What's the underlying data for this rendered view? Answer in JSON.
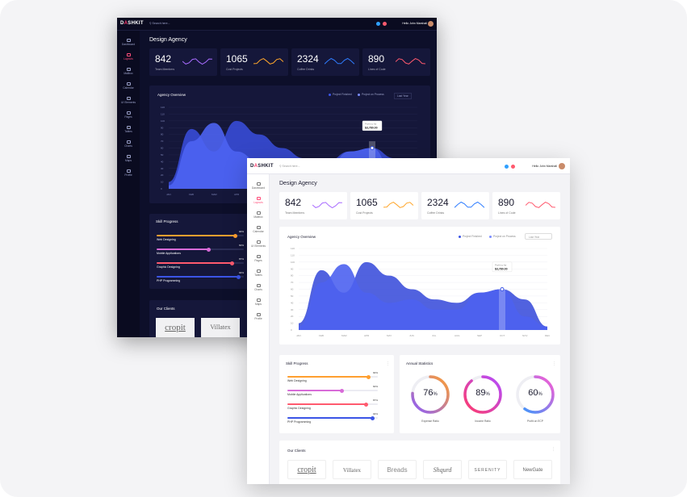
{
  "brand": {
    "name_pre": "D",
    "name_o": "A",
    "name_post": "SHKIT"
  },
  "search_placeholder": "Search here...",
  "greeting": "Hello John Marshall",
  "page_title": "Design Agency",
  "sidebar": [
    "Dashboard",
    "Layouts",
    "Mailbox",
    "Calendar",
    "UI Elements",
    "Pages",
    "Tables",
    "Charts",
    "Maps",
    "Profile"
  ],
  "stats": [
    {
      "value": "842",
      "label": "Team Members",
      "color": "#a86bff"
    },
    {
      "value": "1065",
      "label": "Cost Projects",
      "color": "#ffa62b"
    },
    {
      "value": "2324",
      "label": "Coffee Drinks",
      "color": "#2f7dff"
    },
    {
      "value": "890",
      "label": "Lines of Code",
      "color": "#ff5a6e"
    }
  ],
  "overview": {
    "title": "Agency Overview",
    "legend": [
      "Project Finished",
      "Project on Process"
    ],
    "select": "Last Year",
    "tooltip_label": "Profit so far",
    "tooltip_value": "$3,780.00"
  },
  "chart_data": {
    "type": "area",
    "categories": [
      "JAN",
      "FEB",
      "MAR",
      "APR",
      "MAY",
      "JUN",
      "JUL",
      "AUG",
      "SEP",
      "OCT",
      "NOV",
      "DEC"
    ],
    "ylim": [
      0,
      120
    ],
    "yticks": [
      0,
      10,
      20,
      30,
      40,
      50,
      60,
      70,
      80,
      90,
      100,
      110,
      120
    ],
    "series": [
      {
        "name": "Project Finished",
        "color": "#3b55e6",
        "values": [
          5,
          70,
          97,
          55,
          40,
          45,
          30,
          30,
          55,
          60,
          20,
          5
        ]
      },
      {
        "name": "Project on Process",
        "color": "#4a63f0",
        "values": [
          10,
          88,
          55,
          100,
          80,
          60,
          45,
          40,
          55,
          60,
          45,
          5
        ]
      }
    ]
  },
  "skills": {
    "title": "Skill Progress",
    "items": [
      {
        "name": "Web Designing",
        "value": "90%",
        "pct": 0.9,
        "color": "#ff9f2f"
      },
      {
        "name": "Mobile Applications",
        "value": "60%",
        "pct": 0.6,
        "color": "#d86bd8"
      },
      {
        "name": "Graphic Designing",
        "value": "87%",
        "pct": 0.87,
        "color": "#ff5a6e"
      },
      {
        "name": "PHP Programming",
        "value": "94%",
        "pct": 0.94,
        "color": "#3b55e6"
      }
    ]
  },
  "annual": {
    "title": "Annual Statistics",
    "rings": [
      {
        "value": "76",
        "label": "Expense Ratio",
        "pct": 0.76,
        "c1": "#8a5cff",
        "c2": "#ff9f2f"
      },
      {
        "value": "89",
        "label": "Income Ratio",
        "pct": 0.89,
        "c1": "#ff3b6b",
        "c2": "#b34cff"
      },
      {
        "value": "60",
        "label": "Profit on ECP",
        "pct": 0.6,
        "c1": "#2f9bff",
        "c2": "#ff5ad2"
      }
    ]
  },
  "clients": {
    "title": "Our Clients",
    "logos": [
      "cropit",
      "Villatex",
      "Breads",
      "Shqurd",
      "SERENITY",
      "NewGate"
    ]
  }
}
